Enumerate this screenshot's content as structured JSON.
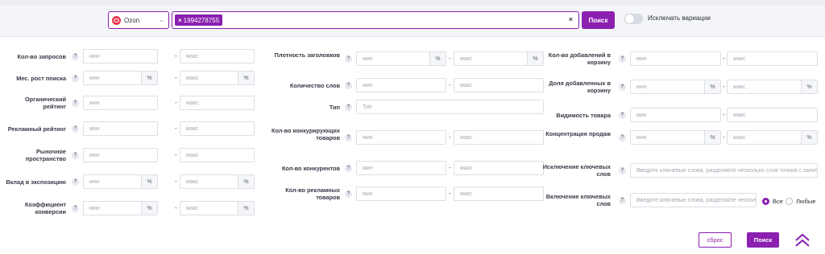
{
  "topbar": {
    "marketplace": {
      "label": "Ozon",
      "icon": "ozon-logo-icon",
      "brand_color": "#e8334a"
    },
    "tags": [
      "1994278755"
    ],
    "tag_remove_glyph": "×",
    "clear_glyph": "×",
    "search_label": "Поиск",
    "exclude_variations_label": "Исключать вариации",
    "exclude_variations_on": false
  },
  "common": {
    "min": "мин",
    "max": "макс",
    "pct": "%",
    "dash": "-",
    "help": "?"
  },
  "columns": [
    [
      {
        "key": "requests",
        "label": "Кол-во запросов",
        "pct": false
      },
      {
        "key": "search-growth",
        "label": "Мес. рост поиска",
        "pct": true
      },
      {
        "key": "organic-rating",
        "label": "Органический рейтинг",
        "pct": false
      },
      {
        "key": "ad-rating",
        "label": "Рекламный рейтинг",
        "pct": false
      },
      {
        "key": "market-space",
        "label": "Рыночное пространство",
        "pct": false
      },
      {
        "key": "exposure-share",
        "label": "Вклад в экспозицию",
        "pct": true
      },
      {
        "key": "conversion",
        "label": "Коэффициент конверсии",
        "pct": true
      }
    ],
    [
      {
        "key": "title-density",
        "label": "Плотность заголовков",
        "pct": true
      },
      {
        "key": "word-count",
        "label": "Количество слов",
        "pct": false
      },
      {
        "key": "type",
        "label": "Тип",
        "single": true,
        "placeholder": "Тип"
      },
      {
        "key": "competing-products",
        "label": "Кол-во конкурирующих товаров",
        "pct": false
      },
      {
        "key": "competitors",
        "label": "Кол-во конкурентов",
        "pct": false
      },
      {
        "key": "ad-products",
        "label": "Кол-во рекламных товаров",
        "pct": false
      }
    ],
    [
      {
        "key": "cart-adds",
        "label": "Кол-во добавлений в корзину",
        "pct": false
      },
      {
        "key": "cart-share",
        "label": "Доля добавленных в корзину",
        "pct": true
      },
      {
        "key": "visibility",
        "label": "Видимость товара",
        "pct": false
      },
      {
        "key": "sales-concentration",
        "label": "Концентрация продаж",
        "pct": true
      },
      {
        "key": "exclude-keywords",
        "label": "Исключение ключевых слов",
        "single": true,
        "placeholder": "Введите ключевые слова, разделяйте несколько слов точкой с запятой"
      },
      {
        "key": "include-keywords",
        "label": "Включение ключевых слов",
        "single": true,
        "placeholder": "Введите ключевые слова, разделяйте несколько слов точкой с запятой"
      }
    ]
  ],
  "match_mode": {
    "options": [
      "Все",
      "Любые"
    ],
    "selected": "Все"
  },
  "footer": {
    "reset_label": "сброс",
    "search_label": "Поиск"
  },
  "colors": {
    "accent": "#8a1fb0",
    "border": "#dcdfe6",
    "topbar_bg": "#f4f5f9"
  }
}
